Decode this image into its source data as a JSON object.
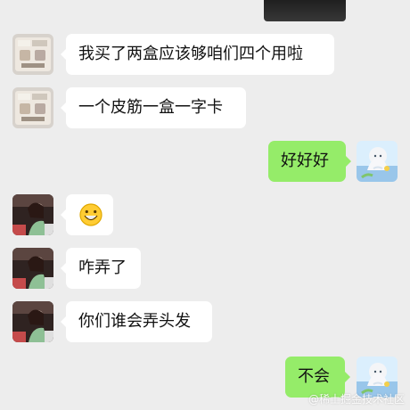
{
  "chat": {
    "messages": [
      {
        "id": "m1",
        "side": "left",
        "text": "我买了两盒应该够咱们四个用啦"
      },
      {
        "id": "m2",
        "side": "left",
        "text": "一个皮筋一盒一字卡"
      },
      {
        "id": "m3",
        "side": "right",
        "text": "好好好"
      },
      {
        "id": "m4",
        "side": "left",
        "text": ""
      },
      {
        "id": "m5",
        "side": "left",
        "text": "咋弄了"
      },
      {
        "id": "m6",
        "side": "left",
        "text": "你们谁会弄头发"
      },
      {
        "id": "m7",
        "side": "right",
        "text": "不会"
      }
    ]
  },
  "watermark": {
    "text": "@稀土掘金技术社区"
  },
  "colors": {
    "background": "#ededed",
    "incoming_bubble": "#ffffff",
    "outgoing_bubble": "#95ec69",
    "text": "#111111"
  },
  "icons": {
    "avatar_a": "sticker-avatar",
    "avatar_b": "anime-girl-avatar",
    "avatar_c": "photo-avatar",
    "emoji": "grinning-face-emoji"
  }
}
